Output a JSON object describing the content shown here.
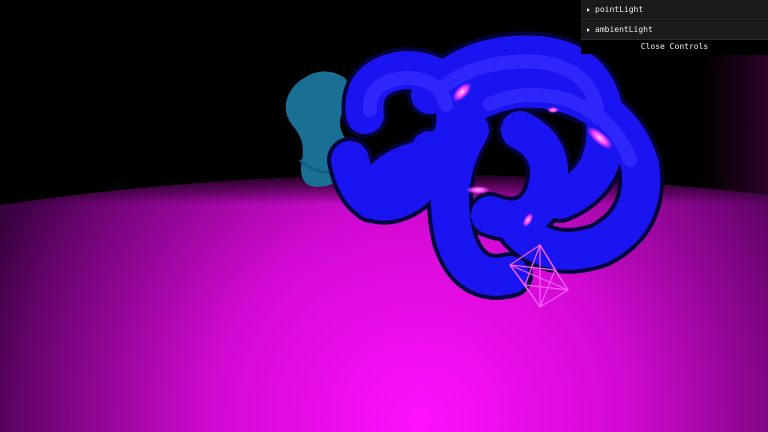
{
  "controls": {
    "folders": [
      {
        "label": "pointLight"
      },
      {
        "label": "ambientLight"
      }
    ],
    "close_label": "Close Controls"
  },
  "scene": {
    "floor_color": "#ff10ff",
    "knot_color": "#1a14f0",
    "blob_color": "#1a6f95",
    "helper_color": "#ff5cff",
    "background_color": "#000000"
  }
}
